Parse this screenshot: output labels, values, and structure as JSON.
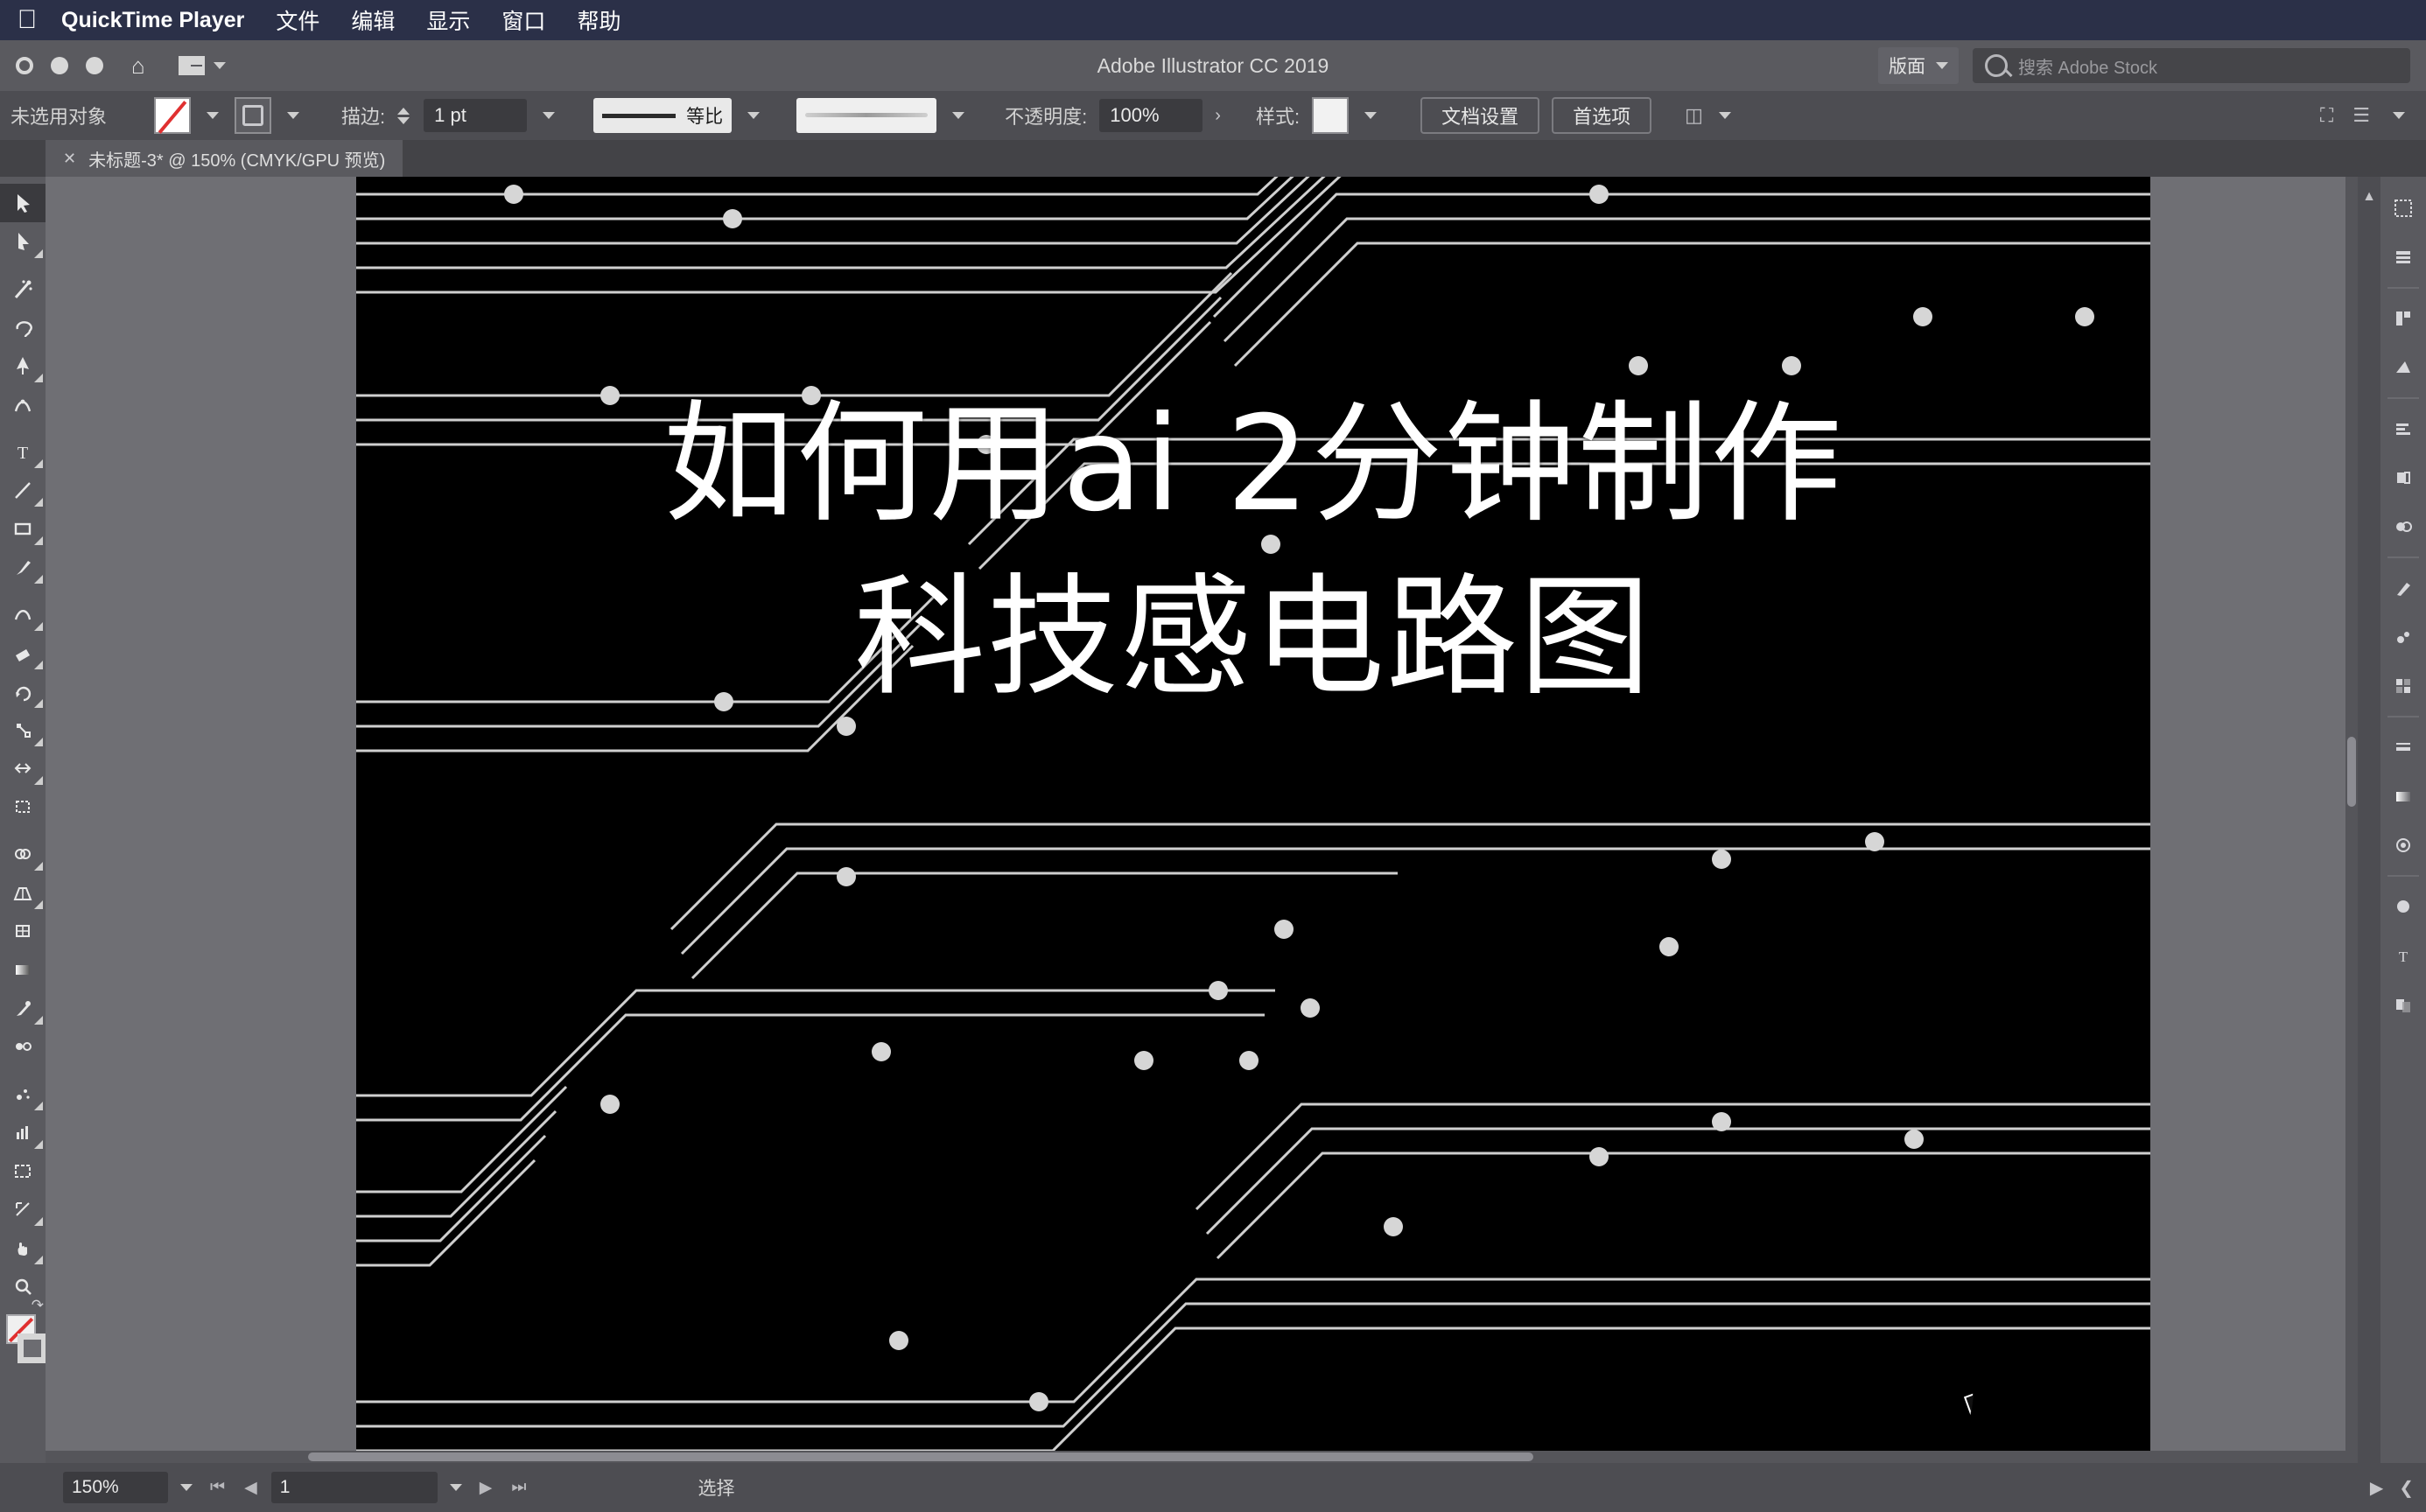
{
  "macbar": {
    "apple_icon": "apple-logo",
    "app_name": "QuickTime Player",
    "items": [
      {
        "label": "文件"
      },
      {
        "label": "编辑"
      },
      {
        "label": "显示"
      },
      {
        "label": "窗口"
      },
      {
        "label": "帮助"
      }
    ]
  },
  "titlebar": {
    "app_title": "Adobe Illustrator CC 2019",
    "home_icon": "home-icon",
    "arrange_icon": "arrange-documents-icon",
    "layout_label": "版面",
    "search_placeholder": "搜索 Adobe Stock",
    "search_icon": "search-icon"
  },
  "controlbar": {
    "selection_status": "未选用对象",
    "fill_swatch": "none-swatch",
    "stroke_swatch": "stroke-swatch",
    "stroke_label": "描边:",
    "stroke_width": "1 pt",
    "profile_label": "等比",
    "brush_definition": "brush-definition",
    "opacity_label": "不透明度:",
    "opacity_value": "100%",
    "style_label": "样式:",
    "doc_setup_button": "文档设置",
    "preferences_button": "首选项",
    "align_icon": "align-icon"
  },
  "tab": {
    "close_icon": "close-icon",
    "title": "未标题-3* @ 150% (CMYK/GPU 预览)"
  },
  "tools": [
    {
      "name": "selection-tool",
      "glyph": "selection",
      "active": true,
      "sub": false
    },
    {
      "name": "direct-selection-tool",
      "glyph": "direct",
      "active": false,
      "sub": true
    },
    {
      "name": "magic-wand-tool",
      "glyph": "wand",
      "active": false,
      "sub": false
    },
    {
      "name": "lasso-tool",
      "glyph": "lasso",
      "active": false,
      "sub": false
    },
    {
      "name": "pen-tool",
      "glyph": "pen",
      "active": false,
      "sub": true
    },
    {
      "name": "curvature-tool",
      "glyph": "curve",
      "active": false,
      "sub": false
    },
    {
      "name": "type-tool",
      "glyph": "type",
      "active": false,
      "sub": true
    },
    {
      "name": "line-segment-tool",
      "glyph": "line",
      "active": false,
      "sub": true
    },
    {
      "name": "rectangle-tool",
      "glyph": "rect",
      "active": false,
      "sub": true
    },
    {
      "name": "paintbrush-tool",
      "glyph": "brush",
      "active": false,
      "sub": true
    },
    {
      "name": "shaper-tool",
      "glyph": "shaper",
      "active": false,
      "sub": true
    },
    {
      "name": "eraser-tool",
      "glyph": "eraser",
      "active": false,
      "sub": true
    },
    {
      "name": "rotate-tool",
      "glyph": "rotate",
      "active": false,
      "sub": true
    },
    {
      "name": "scale-tool",
      "glyph": "scale",
      "active": false,
      "sub": true
    },
    {
      "name": "width-tool",
      "glyph": "width",
      "active": false,
      "sub": true
    },
    {
      "name": "free-transform-tool",
      "glyph": "transform",
      "active": false,
      "sub": false
    },
    {
      "name": "shape-builder-tool",
      "glyph": "builder",
      "active": false,
      "sub": true
    },
    {
      "name": "perspective-grid-tool",
      "glyph": "perspective",
      "active": false,
      "sub": true
    },
    {
      "name": "mesh-tool",
      "glyph": "mesh",
      "active": false,
      "sub": false
    },
    {
      "name": "gradient-tool",
      "glyph": "gradient",
      "active": false,
      "sub": false
    },
    {
      "name": "eyedropper-tool",
      "glyph": "eyedropper",
      "active": false,
      "sub": true
    },
    {
      "name": "blend-tool",
      "glyph": "blend",
      "active": false,
      "sub": false
    },
    {
      "name": "symbol-sprayer-tool",
      "glyph": "symbol",
      "active": false,
      "sub": true
    },
    {
      "name": "column-graph-tool",
      "glyph": "graph",
      "active": false,
      "sub": true
    },
    {
      "name": "artboard-tool",
      "glyph": "artboard",
      "active": false,
      "sub": false
    },
    {
      "name": "slice-tool",
      "glyph": "slice",
      "active": false,
      "sub": true
    },
    {
      "name": "hand-tool",
      "glyph": "hand",
      "active": false,
      "sub": true
    },
    {
      "name": "zoom-tool",
      "glyph": "zoom",
      "active": false,
      "sub": false
    }
  ],
  "right_panels": [
    {
      "name": "properties-panel-icon",
      "glyph": "props"
    },
    {
      "name": "layers-panel-icon",
      "glyph": "layers"
    },
    {
      "name": "libraries-panel-icon",
      "glyph": "libraries"
    },
    {
      "name": "color-panel-icon",
      "glyph": "color"
    },
    {
      "name": "align-panel-icon",
      "glyph": "align"
    },
    {
      "name": "transform-panel-icon",
      "glyph": "transform"
    },
    {
      "name": "pathfinder-panel-icon",
      "glyph": "pathfinder"
    },
    {
      "name": "brushes-panel-icon",
      "glyph": "brushes"
    },
    {
      "name": "symbols-panel-icon",
      "glyph": "symbols"
    },
    {
      "name": "swatches-panel-icon",
      "glyph": "swatches"
    },
    {
      "name": "stroke-panel-icon",
      "glyph": "stroke"
    },
    {
      "name": "gradient-panel-icon",
      "glyph": "gradient"
    },
    {
      "name": "appearance-panel-icon",
      "glyph": "appearance"
    },
    {
      "name": "graphic-styles-panel-icon",
      "glyph": "styles"
    },
    {
      "name": "type-panel-icon",
      "glyph": "type"
    },
    {
      "name": "transparency-panel-icon",
      "glyph": "transparency"
    }
  ],
  "canvas": {
    "overlay_line1": "如何用ai 2分钟制作",
    "overlay_line2": "科技感电路图",
    "artboard_background": "#000000",
    "trace_color": "#d8d8d8",
    "canvas_background": "#6f6f74",
    "cursor_icon": "mouse-cursor"
  },
  "statusbar": {
    "zoom_level": "150%",
    "first_page_icon": "first-page-icon",
    "prev_page_icon": "prev-page-icon",
    "page_number": "1",
    "next_page_icon": "next-page-icon",
    "last_page_icon": "last-page-icon",
    "status_text": "选择"
  }
}
